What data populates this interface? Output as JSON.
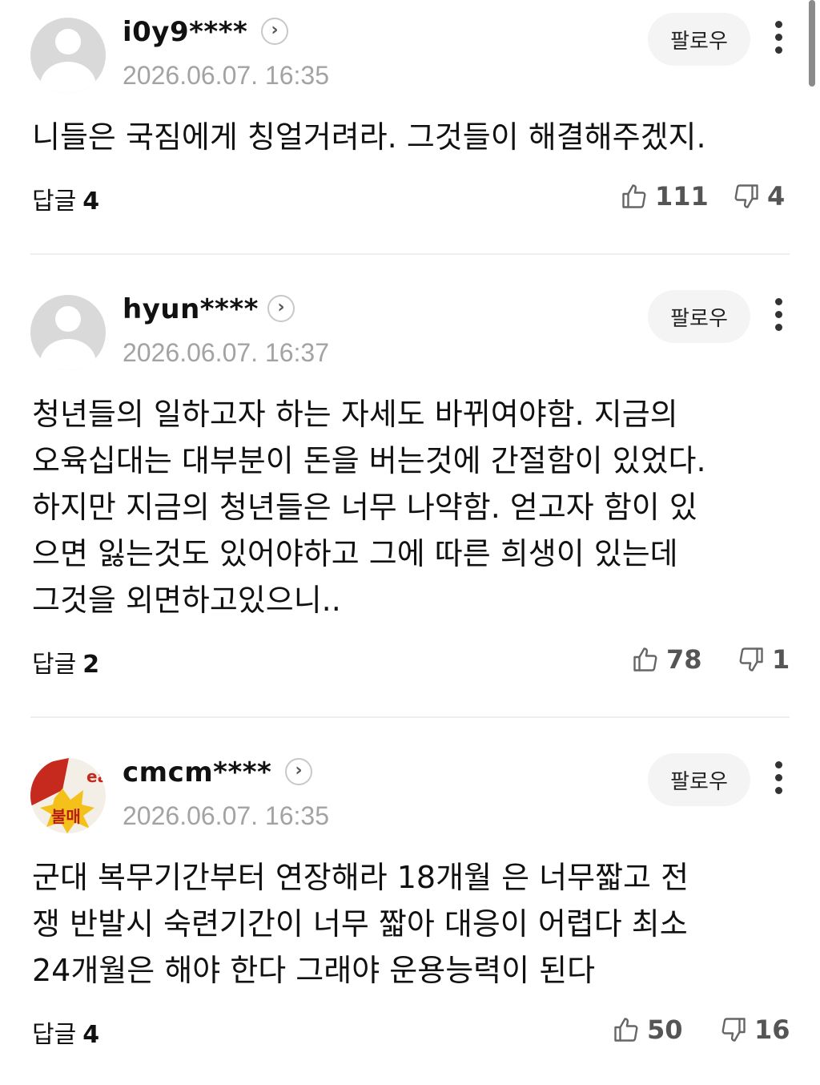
{
  "comments": [
    {
      "username": "i0y9****",
      "date": "2026.06.07. 16:35",
      "follow_label": "팔로우",
      "text": "니들은 국짐에게 칭얼거려라. 그것들이 해결해주겠지.",
      "reply_label": "답글",
      "reply_count": "4",
      "likes": "111",
      "dislikes": "4"
    },
    {
      "username": "hyun****",
      "date": "2026.06.07. 16:37",
      "follow_label": "팔로우",
      "text": "청년들의 일하고자 하는 자세도 바뀌여야함. 지금의\n오육십대는 대부분이 돈을 버는것에 간절함이 있었다.\n하지만 지금의 청년들은 너무 나약함. 얻고자 함이 있\n으면 잃는것도 있어야하고 그에 따른 희생이 있는데\n그것을 외면하고있으니..",
      "reply_label": "답글",
      "reply_count": "2",
      "likes": "78",
      "dislikes": "1"
    },
    {
      "username": "cmcm****",
      "date": "2026.06.07. 16:35",
      "follow_label": "팔로우",
      "avatar_text": "불매",
      "text": "군대 복무기간부터 연장해라 18개월 은 너무짧고 전\n쟁 반발시 숙련기간이 너무 짧아 대응이 어렵다 최소\n24개월은 해야 한다 그래야 운용능력이 된다",
      "reply_label": "답글",
      "reply_count": "4",
      "likes": "50",
      "dislikes": "16"
    }
  ],
  "icons": {
    "profile_link": "chevron-right-icon",
    "more": "more-vertical-icon",
    "like": "thumbs-up-icon",
    "dislike": "thumbs-down-icon"
  }
}
